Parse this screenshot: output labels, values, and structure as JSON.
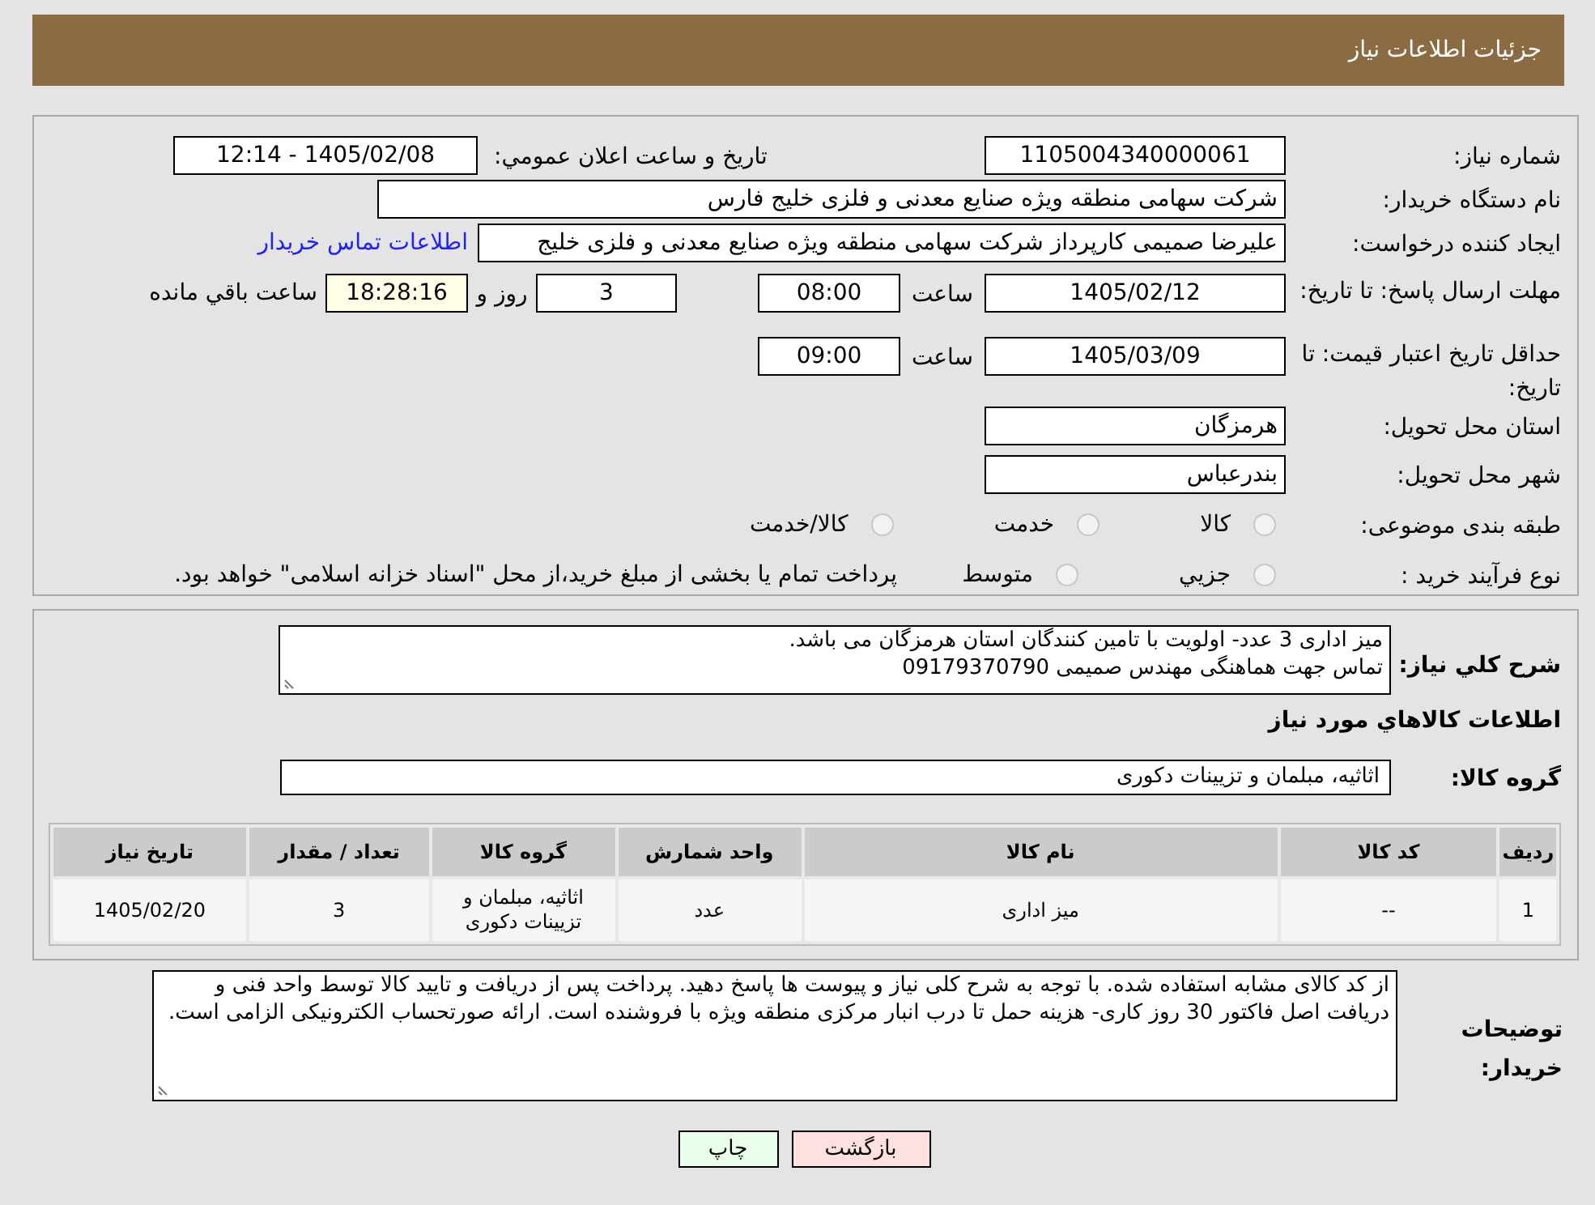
{
  "header": {
    "title": "جزئیات اطلاعات نیاز"
  },
  "fields": {
    "need_number": {
      "label": "شماره نیاز:",
      "value": "1105004340000061"
    },
    "announce": {
      "label": "تاریخ و ساعت اعلان عمومي:",
      "value": "1405/02/08 - 12:14"
    },
    "buyer": {
      "label": "نام دستگاه خریدار:",
      "value": "شرکت سهامی منطقه ویژه صنایع معدنی و فلزی خلیج فارس"
    },
    "creator": {
      "label": "ایجاد کننده درخواست:",
      "value": "علیرضا صمیمی کارپرداز شرکت سهامی منطقه ویژه صنایع معدنی و فلزی خلیج",
      "link": "اطلاعات تماس خریدار"
    },
    "deadline": {
      "label": "مهلت ارسال پاسخ: تا تاریخ:",
      "date": "1405/02/12",
      "time_label": "ساعت",
      "time": "08:00",
      "days": "3",
      "days_label": "روز و",
      "remaining": "18:28:16",
      "remaining_label": "ساعت باقي مانده"
    },
    "validity": {
      "label": "حداقل تاریخ اعتبار قیمت: تا تاریخ:",
      "date": "1405/03/09",
      "time_label": "ساعت",
      "time": "09:00"
    },
    "province": {
      "label": "استان محل تحویل:",
      "value": "هرمزگان"
    },
    "city": {
      "label": "شهر محل تحویل:",
      "value": "بندرعباس"
    },
    "category": {
      "label": "طبقه بندی موضوعی:",
      "options": [
        {
          "label": "کالا",
          "selected": false
        },
        {
          "label": "خدمت",
          "selected": false
        },
        {
          "label": "کالا/خدمت",
          "selected": false
        }
      ]
    },
    "process": {
      "label": "نوع فرآیند خرید :",
      "options": [
        {
          "label": "جزيي",
          "selected": false
        },
        {
          "label": "متوسط",
          "selected": false
        }
      ],
      "note": "پرداخت تمام یا بخشی از مبلغ خرید،از محل \"اسناد خزانه اسلامی\" خواهد بود."
    }
  },
  "description": {
    "label": "شرح کلي نیاز:",
    "lines": [
      "میز اداری 3 عدد- اولویت با تامین کنندگان استان هرمزگان می باشد.",
      "تماس جهت هماهنگی مهندس صمیمی 09179370790"
    ]
  },
  "goods_title": "اطلاعات کالاهاي مورد نیاز",
  "goods_group": {
    "label": "گروه کالا:",
    "value": "اثاثیه، مبلمان و تزیینات دکوری"
  },
  "table": {
    "columns": [
      "ردیف",
      "کد کالا",
      "نام کالا",
      "واحد شمارش",
      "گروه کالا",
      "تعداد / مقدار",
      "تاریخ نیاز"
    ],
    "rows": [
      [
        "1",
        "--",
        "میز اداری",
        "عدد",
        "اثاثیه، مبلمان و تزیینات دکوری",
        "3",
        "1405/02/20"
      ]
    ]
  },
  "buyer_notes": {
    "label": "توضیحات خریدار:",
    "value": "از کد کالای مشابه استفاده شده. با توجه به شرح کلی نیاز و پیوست ها پاسخ دهید. پرداخت پس از دریافت و تایید کالا توسط واحد فنی و دریافت اصل فاکتور 30 روز کاری- هزینه حمل تا درب انبار مرکزی منطقه ویژه با فروشنده است. ارائه صورتحساب الکترونیکی الزامی است."
  },
  "buttons": [
    {
      "label": "بازگشت",
      "kind": "back"
    },
    {
      "label": "چاپ",
      "kind": "print"
    }
  ]
}
